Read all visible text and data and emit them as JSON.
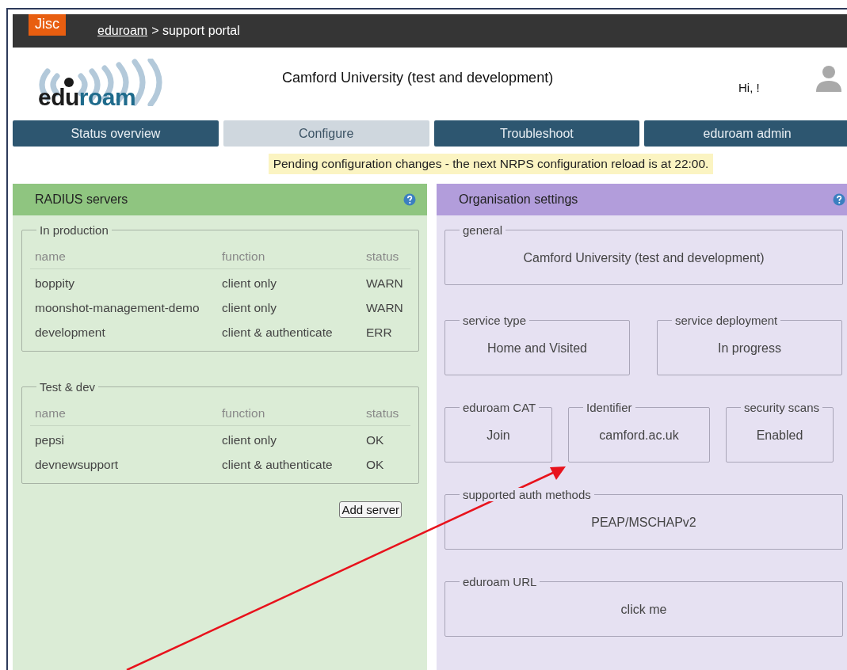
{
  "topbar": {
    "logo": "Jisc",
    "breadcrumb_link": "eduroam",
    "breadcrumb_rest": "> support portal"
  },
  "header": {
    "logo_dark": "edu",
    "logo_light": "roam",
    "organisation": "Camford University (test and development)",
    "greeting": "Hi, !"
  },
  "tabs": [
    {
      "label": "Status overview",
      "selected": false
    },
    {
      "label": "Configure",
      "selected": true
    },
    {
      "label": "Troubleshoot",
      "selected": false
    },
    {
      "label": "eduroam admin",
      "selected": false
    }
  ],
  "notice": "Pending configuration changes - the next NRPS configuration reload is at 22:00.",
  "radius_panel": {
    "title": "RADIUS servers",
    "groups": [
      {
        "legend": "In production",
        "columns": [
          "name",
          "function",
          "status"
        ],
        "rows": [
          {
            "name": "boppity",
            "function": "client only",
            "status": "WARN"
          },
          {
            "name": "moonshot-management-demo",
            "function": "client only",
            "status": "WARN"
          },
          {
            "name": "development",
            "function": "client & authenticate",
            "status": "ERR"
          }
        ]
      },
      {
        "legend": "Test & dev",
        "columns": [
          "name",
          "function",
          "status"
        ],
        "rows": [
          {
            "name": "pepsi",
            "function": "client only",
            "status": "OK"
          },
          {
            "name": "devnewsupport",
            "function": "client & authenticate",
            "status": "OK"
          }
        ]
      }
    ],
    "button": "Add server"
  },
  "org_panel": {
    "title": "Organisation settings",
    "settings": [
      {
        "kind": "full",
        "legend": "general",
        "value": "Camford University (test and development)"
      },
      {
        "kind": "half",
        "legend": "service type",
        "value": "Home and Visited"
      },
      {
        "kind": "half",
        "legend": "service deployment",
        "value": "In progress"
      },
      {
        "kind": "narrow",
        "legend": "eduroam CAT",
        "value": "Join"
      },
      {
        "kind": "wide",
        "legend": "Identifier",
        "value": "camford.ac.uk"
      },
      {
        "kind": "narrow",
        "legend": "security scans",
        "value": "Enabled"
      },
      {
        "kind": "full",
        "legend": "supported auth methods",
        "value": "PEAP/MSCHAPv2"
      },
      {
        "kind": "full",
        "legend": "eduroam URL",
        "value": "click me"
      }
    ]
  }
}
